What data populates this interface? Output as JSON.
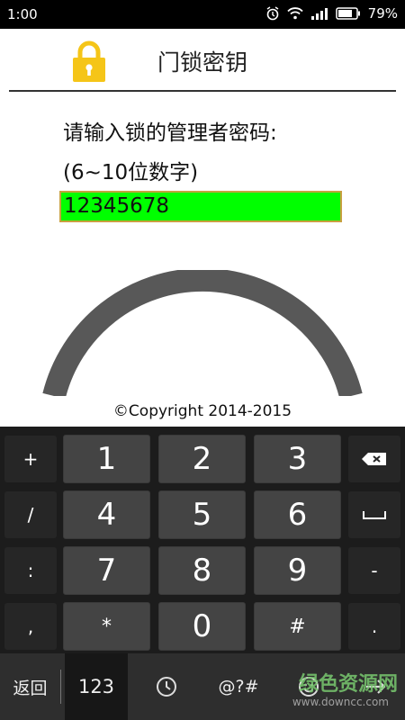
{
  "status_bar": {
    "time": "1:00",
    "battery": "79%"
  },
  "app": {
    "title": "门锁密钥"
  },
  "prompt": {
    "line1": "请输入锁的管理者密码:",
    "line2": "(6~10位数字)"
  },
  "password_field": {
    "value": "12345678"
  },
  "copyright": "©Copyright 2014-2015",
  "keyboard": {
    "left_column": [
      "+",
      "/",
      ":",
      ","
    ],
    "rows": [
      [
        "1",
        "2",
        "3"
      ],
      [
        "4",
        "5",
        "6"
      ],
      [
        "7",
        "8",
        "9"
      ],
      [
        "*",
        "0",
        "#"
      ]
    ],
    "right_column": [
      "backspace",
      "space",
      "-",
      "."
    ],
    "bottom": {
      "back": "返回",
      "mode_123": "123",
      "symbols": "@?#"
    }
  },
  "watermark": {
    "text": "绿色资源网",
    "url": "www.downcc.com"
  },
  "colors": {
    "field_bg": "#00ff00",
    "lock_icon": "#f5c518",
    "keyboard_bg": "#1c1c1c"
  }
}
